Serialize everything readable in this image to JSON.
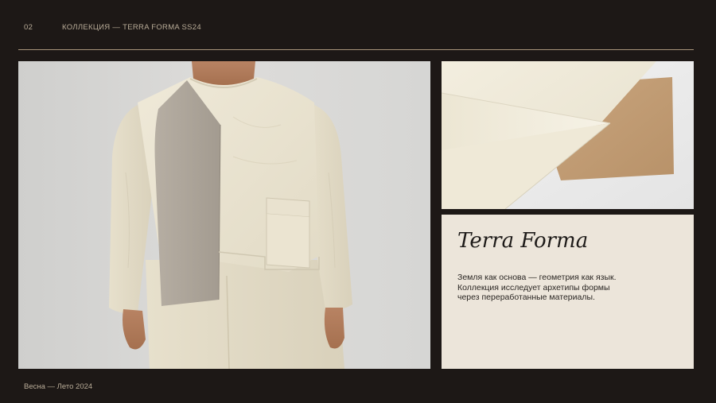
{
  "header": {
    "page_number": "02",
    "collection_label": "КОЛЛЕКЦИЯ — TERRA FORMA SS24"
  },
  "panel": {
    "title": "Terra Forma",
    "description_lines": [
      "Земля как основа — геометрия как язык.",
      "Коллекция исследует архетипы формы",
      "через переработанные материалы."
    ]
  },
  "footer": {
    "season": "Весна — Лето 2024"
  },
  "colors": {
    "background": "#1d1816",
    "accent_line": "#a8957a",
    "panel": "#ece5da",
    "muted_text": "#b9ac98"
  }
}
